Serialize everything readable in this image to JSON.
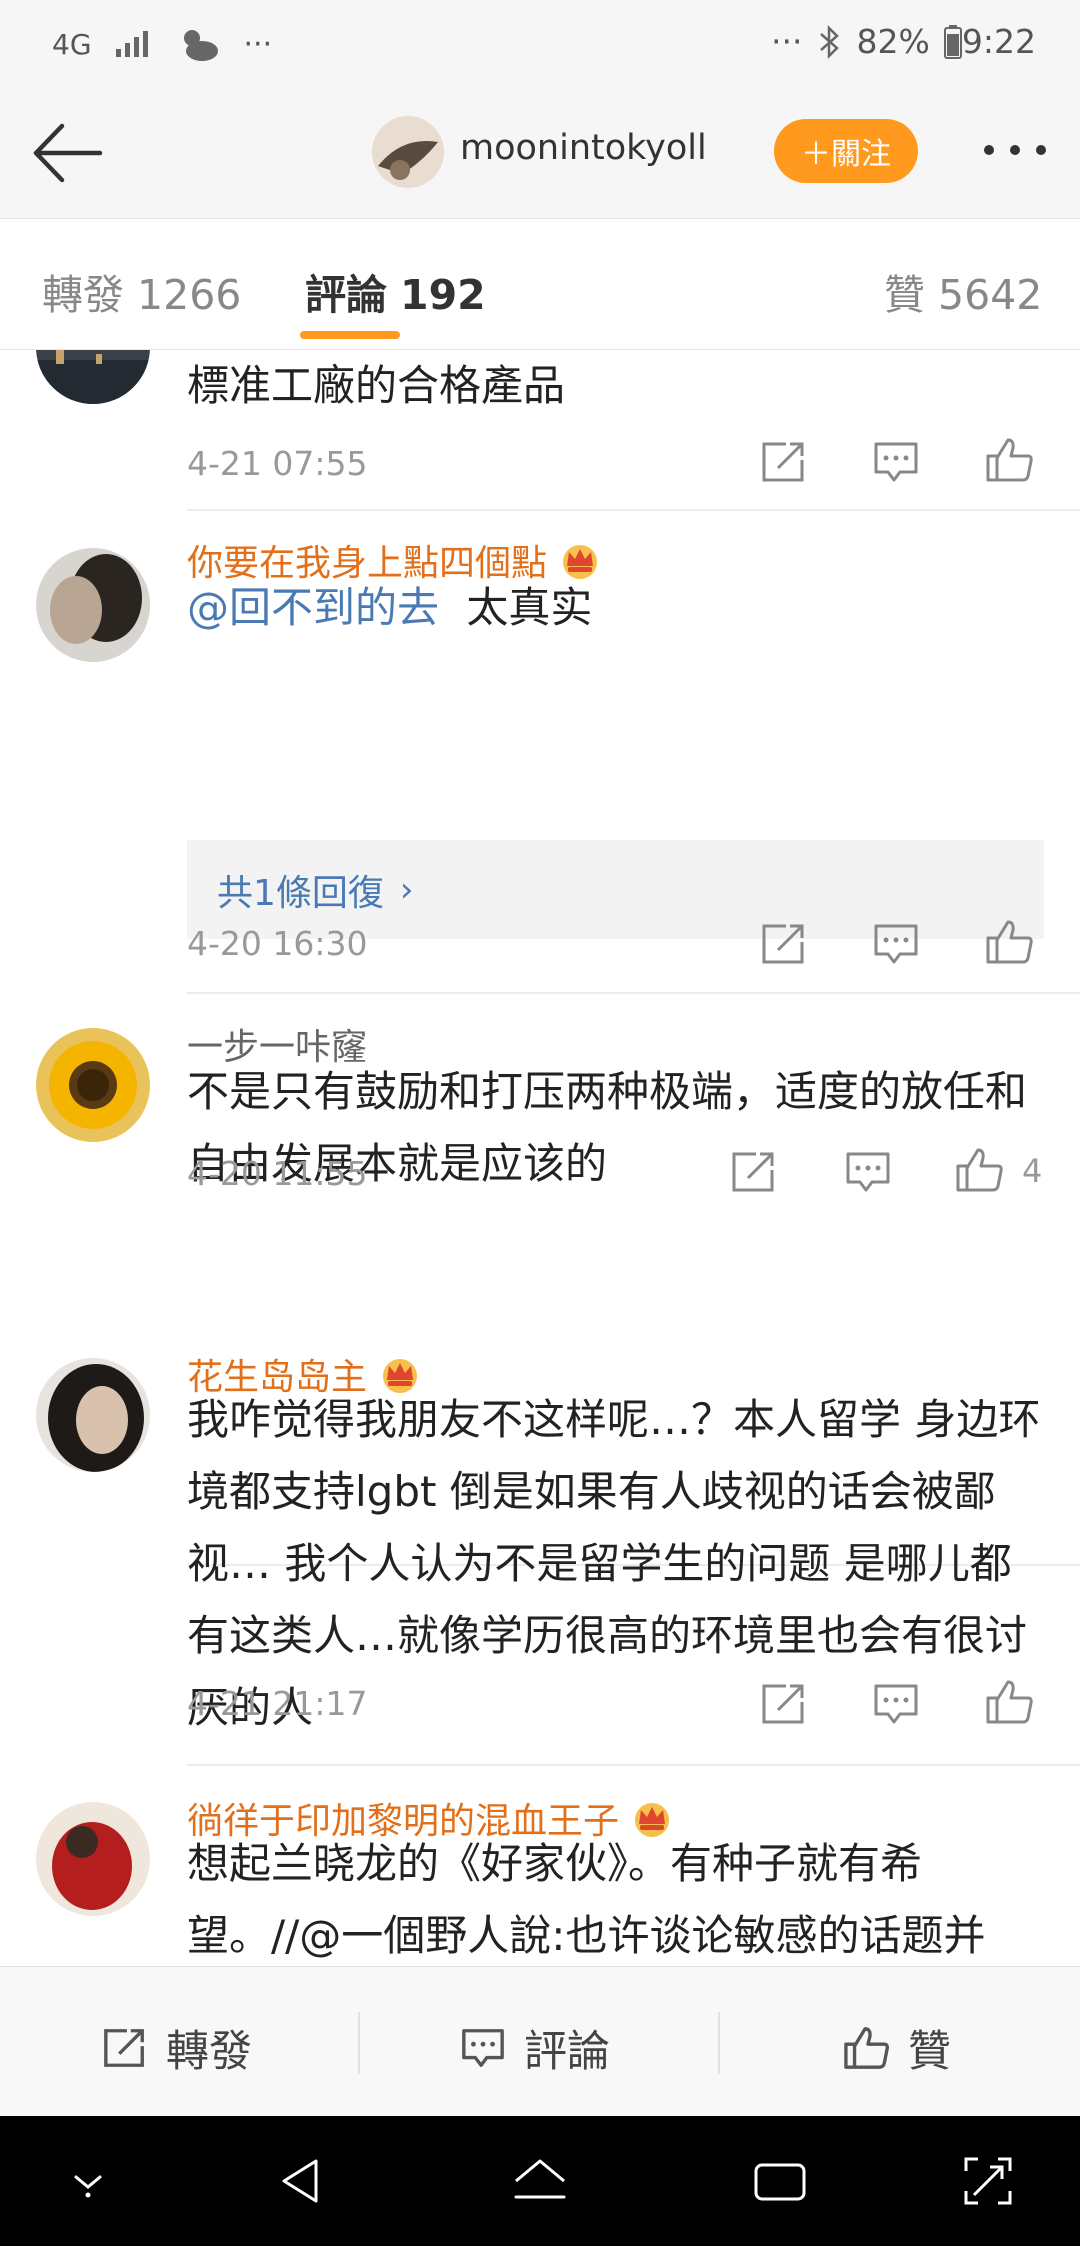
{
  "status": {
    "network": "4G",
    "dots": "···",
    "battery": "82%",
    "time": "9:22"
  },
  "header": {
    "username": "moonintokyoll",
    "follow_label": "＋關注"
  },
  "tabs": [
    {
      "name": "轉發",
      "count": "1266"
    },
    {
      "name": "評論",
      "count": "192"
    },
    {
      "name": "贊",
      "count": "5642"
    }
  ],
  "comments": [
    {
      "text": "標准工廠的合格產品",
      "time": "4-21 07:55"
    },
    {
      "name": "你要在我身上點四個點",
      "mention": "@回不到的去",
      "text": "太真实",
      "replies": "共1條回復",
      "time": "4-20 16:30"
    },
    {
      "name": "一步一咔窿",
      "text": "不是只有鼓励和打压两种极端，适度的放任和自由发展本就是应该的",
      "time": "4-20 11:55",
      "likes": "4"
    },
    {
      "name": "花生岛岛主",
      "text": "我咋觉得我朋友不这样呢…？本人留学 身边环境都支持lgbt 倒是如果有人歧视的话会被鄙视… 我个人认为不是留学生的问题 是哪儿都有这类人…就像学历很高的环境里也会有很讨厌的人",
      "time": "4-21 21:17"
    },
    {
      "name": "徜徉于印加黎明的混血王子",
      "text": "想起兰晓龙的《好家伙》。有种子就有希望。//@一個野人說:也许谈论敏感的话题并"
    }
  ],
  "bottom": {
    "repost": "轉發",
    "comment": "評論",
    "like": "贊"
  },
  "colors": {
    "accent": "#ff9a1f",
    "name_vip": "#e2701a",
    "link": "#4a7ab4"
  }
}
